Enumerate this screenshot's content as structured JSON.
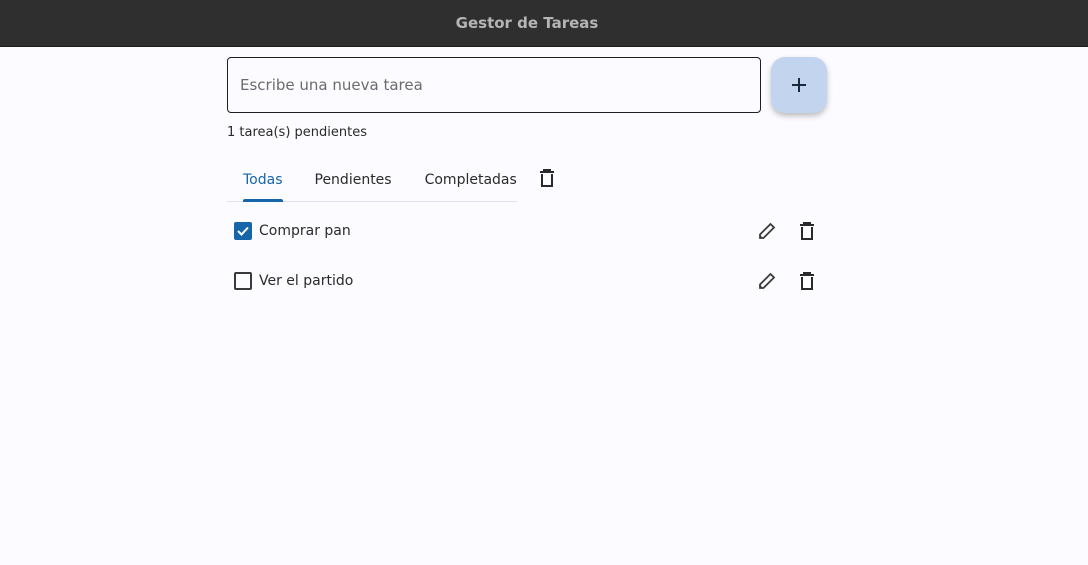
{
  "app": {
    "title": "Gestor de Tareas"
  },
  "input": {
    "placeholder": "Escribe una nueva tarea",
    "value": ""
  },
  "add_button": {
    "icon": "plus-icon"
  },
  "status": {
    "pending_text": "1 tarea(s) pendientes"
  },
  "tabs": [
    {
      "label": "Todas",
      "active": true
    },
    {
      "label": "Pendientes",
      "active": false
    },
    {
      "label": "Completadas",
      "active": false
    }
  ],
  "clear_button": {
    "icon": "trash-icon"
  },
  "tasks": [
    {
      "label": "Comprar pan",
      "completed": true
    },
    {
      "label": "Ver el partido",
      "completed": false
    }
  ],
  "colors": {
    "titlebar": "#2f2f2f",
    "accent": "#1565a8",
    "fab": "#c3d5ee",
    "background": "#fcfbff"
  }
}
